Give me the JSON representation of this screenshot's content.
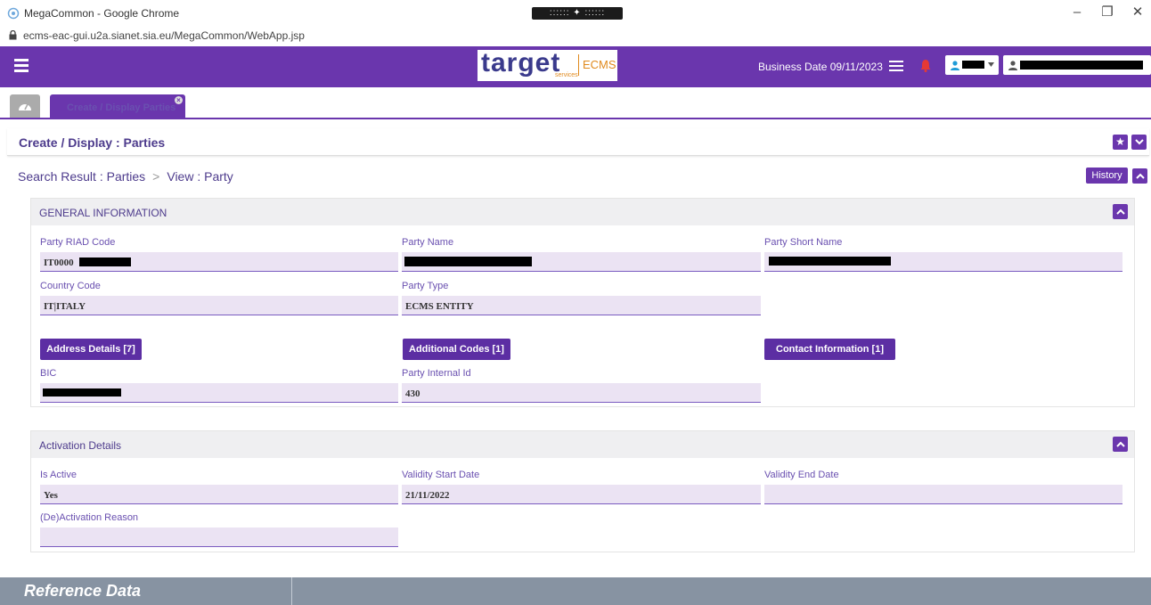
{
  "window": {
    "title": "MegaCommon - Google Chrome",
    "handle_dots": ":::::: ✦ ::::::",
    "controls": {
      "minimize": "–",
      "restore": "❐",
      "close": "✕"
    }
  },
  "address_bar": {
    "url": "ecms-eac-gui.u2a.sianet.sia.eu/MegaCommon/WebApp.jsp"
  },
  "header": {
    "logo": {
      "main": "target",
      "sub": "services",
      "product": "ECMS"
    },
    "business_date": "Business Date 09/11/2023",
    "accent": "#6a36ad"
  },
  "tabs": {
    "active_label": "Create / Display Parties"
  },
  "page": {
    "title": "Create / Display : Parties",
    "breadcrumb": {
      "first": "Search Result : Parties",
      "second": "View : Party"
    },
    "history_label": "History"
  },
  "general": {
    "title": "GENERAL INFORMATION",
    "party_riad_code": {
      "label": "Party RIAD Code",
      "value": "IT0000"
    },
    "party_name": {
      "label": "Party Name",
      "value": ""
    },
    "party_short_name": {
      "label": "Party Short Name",
      "value": ""
    },
    "country_code": {
      "label": "Country Code",
      "value": "IT|ITALY"
    },
    "party_type": {
      "label": "Party Type",
      "value": "ECMS ENTITY"
    },
    "buttons": {
      "address": "Address Details [7]",
      "additional_codes": "Additional Codes [1]",
      "contact": "Contact Information [1]"
    },
    "bic": {
      "label": "BIC",
      "value": ""
    },
    "party_internal_id": {
      "label": "Party Internal Id",
      "value": "430"
    }
  },
  "activation": {
    "title": "Activation Details",
    "is_active": {
      "label": "Is Active",
      "value": "Yes"
    },
    "validity_start": {
      "label": "Validity Start Date",
      "value": "21/11/2022"
    },
    "validity_end": {
      "label": "Validity End Date",
      "value": ""
    },
    "reason": {
      "label": "(De)Activation Reason",
      "value": ""
    }
  },
  "footer": {
    "title": "Reference Data"
  }
}
